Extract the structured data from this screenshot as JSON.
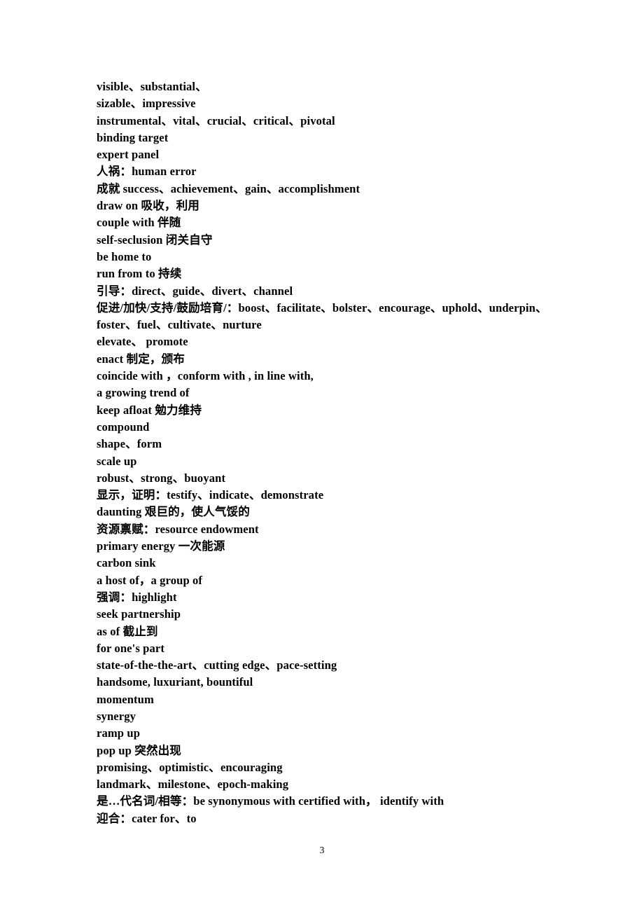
{
  "document": {
    "page_number": "3",
    "background_color": "#ffffff",
    "text_color": "#000000",
    "lines": [
      "visible、substantial、",
      "sizable、impressive",
      "instrumental、vital、crucial、critical、pivotal",
      "binding target",
      "expert panel",
      "人祸：human error",
      "成就 success、achievement、gain、accomplishment",
      "draw on 吸收，利用",
      "couple with 伴随",
      "self-seclusion 闭关自守",
      "be home to",
      "run from to 持续",
      "引导：direct、guide、divert、channel",
      "促进/加快/支持/鼓励培育/：boost、facilitate、bolster、encourage、uphold、underpin、foster、fuel、cultivate、nurture",
      "elevate、 promote",
      "enact 制定，颁布",
      "coincide with ，conform with , in line with,",
      "a growing trend of",
      "keep afloat 勉力维持",
      "compound",
      "shape、form",
      "scale up",
      "robust、strong、buoyant",
      "显示，证明：testify、indicate、demonstrate",
      "daunting 艰巨的，使人气馁的",
      "资源禀赋：resource endowment",
      "primary energy 一次能源",
      "carbon sink",
      "a host of，a group of",
      "强调：highlight",
      "seek partnership",
      "as of 截止到",
      "for one's part",
      "state-of-the-the-art、cutting edge、pace-setting",
      "handsome, luxuriant, bountiful",
      "momentum",
      "synergy",
      "ramp up",
      "pop up 突然出现",
      "promising、optimistic、encouraging",
      "landmark、milestone、epoch-making",
      "是…代名词/相等：be synonymous with certified with， identify with",
      "迎合：cater for、to"
    ]
  }
}
